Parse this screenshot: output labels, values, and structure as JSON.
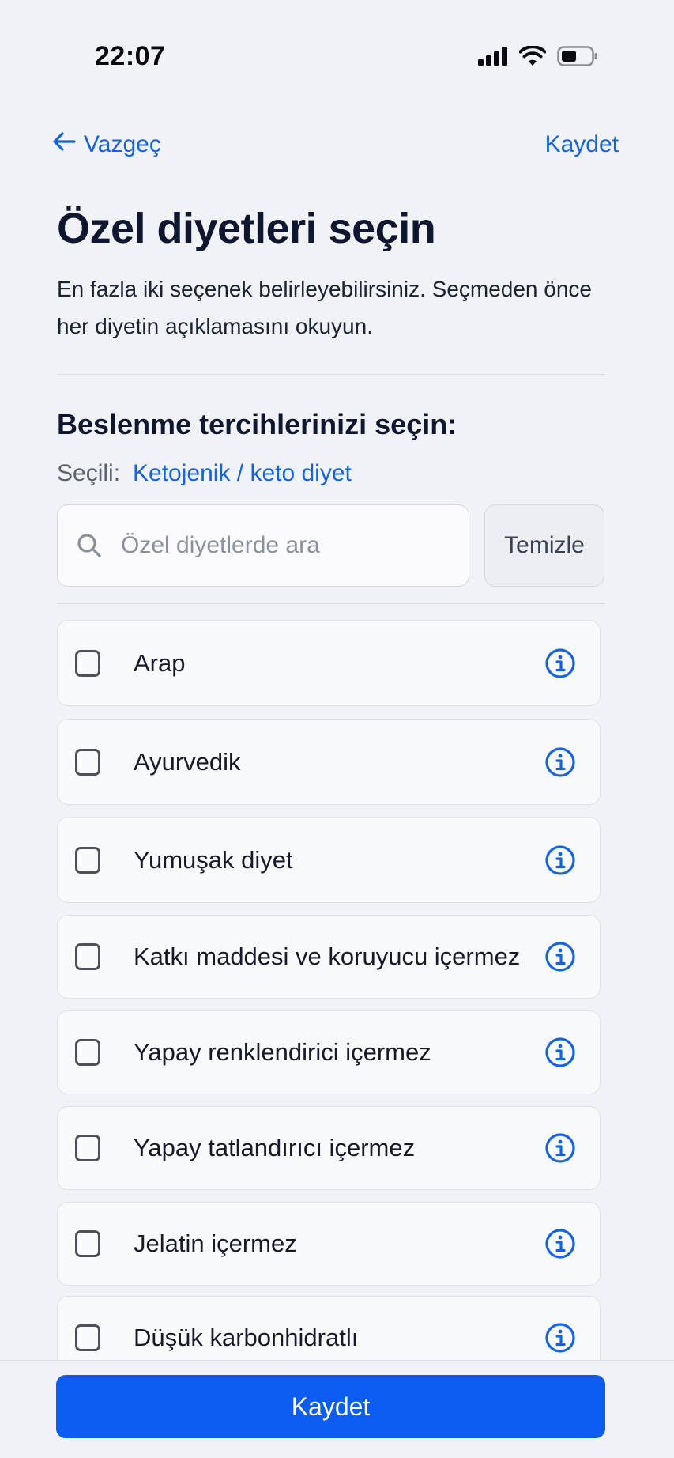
{
  "status_bar": {
    "time": "22:07"
  },
  "nav": {
    "back_label": "Vazgeç",
    "save_label": "Kaydet"
  },
  "page": {
    "title": "Özel diyetleri seçin",
    "subtitle": "En fazla iki seçenek belirleyebilirsiniz. Seçmeden önce her diyetin açıklamasını okuyun."
  },
  "section": {
    "title": "Beslenme tercihlerinizi seçin:",
    "selected_label": "Seçili:",
    "selected_value": "Ketojenik / keto diyet"
  },
  "search": {
    "placeholder": "Özel diyetlerde ara",
    "value": "",
    "clear_label": "Temizle"
  },
  "diets": [
    {
      "label": "Arap",
      "checked": false
    },
    {
      "label": "Ayurvedik",
      "checked": false
    },
    {
      "label": "Yumuşak diyet",
      "checked": false
    },
    {
      "label": "Katkı maddesi ve koruyucu içermez",
      "checked": false
    },
    {
      "label": "Yapay renklendirici içermez",
      "checked": false
    },
    {
      "label": "Yapay tatlandırıcı içermez",
      "checked": false
    },
    {
      "label": "Jelatin içermez",
      "checked": false
    },
    {
      "label": "Düşük karbonhidratlı",
      "checked": false
    }
  ],
  "footer": {
    "save_label": "Kaydet"
  },
  "colors": {
    "accent": "#1463e6",
    "primary_button": "#0b5cf0",
    "background": "#f1f2f6"
  }
}
